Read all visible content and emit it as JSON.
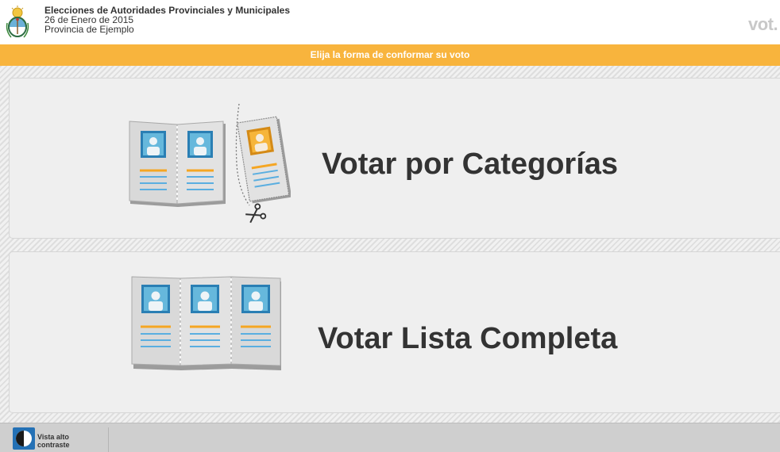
{
  "header": {
    "title": "Elecciones de Autoridades Provinciales y Municipales",
    "date": "26 de Enero de 2015",
    "province": "Provincia de Ejemplo",
    "logo_text": "vot.",
    "emblem_icon": "argentina-coat-of-arms-icon"
  },
  "banner": {
    "text": "Elija la forma de conformar su voto",
    "color": "#f8b43d"
  },
  "options": [
    {
      "label": "Votar por Categorías",
      "icon": "split-ballot-scissors-icon"
    },
    {
      "label": "Votar Lista Completa",
      "icon": "full-ballot-icon"
    }
  ],
  "footer": {
    "contrast_label": "Vista alto contraste",
    "contrast_icon": "contrast-icon"
  }
}
